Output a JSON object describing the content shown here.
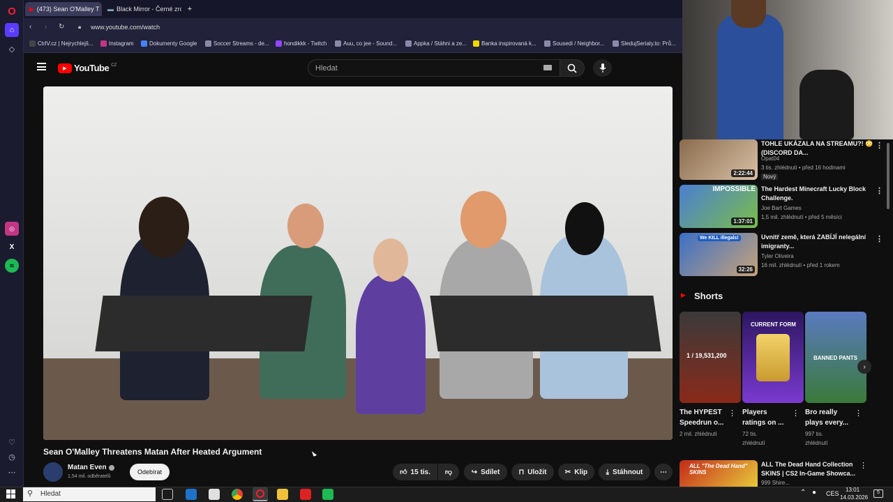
{
  "browser": {
    "tabs": [
      {
        "label": "(473) Sean O'Malley T"
      },
      {
        "label": "Black Mirror - Černé zrcad"
      }
    ],
    "url": "www.youtube.com/watch",
    "bookmarks": [
      "CtrlV.cz | Nejrychlejš...",
      "Instagram",
      "Dokumenty Google",
      "Soccer Streams - de...",
      "hondikkk - Twitch",
      "Auu, co jee - Sound...",
      "Appka / Stáhni a ze...",
      "Banka inspirovaná k...",
      "Sousedi / Neighbor...",
      "SledujSerialy.to: Prů..."
    ]
  },
  "youtube": {
    "logo": "YouTube",
    "country": "CZ",
    "search_placeholder": "Hledat",
    "video": {
      "title": "Sean O'Malley Threatens Matan After Heated Argument",
      "channel": "Matan Even",
      "subscribers": "1,54 mil. odběratelů",
      "subscribe_label": "Odebírat",
      "likes": "15 tis.",
      "share": "Sdílet",
      "save": "Uložit",
      "clip": "Klip",
      "download": "Stáhnout"
    },
    "recommended": [
      {
        "title": "TOHLE UKÁZALA NA STREAMU?! 😳 (DISCORD DA...",
        "channel": "Opat04",
        "meta": "3 tis. zhlédnutí • před 16 hodinami",
        "badge": "Nový",
        "duration": "2:22:44"
      },
      {
        "title": "The Hardest Minecraft Lucky Block Challenge.",
        "channel": "Joe Bart Games",
        "meta": "1,5 mil. zhlédnutí • před 5 měsíci",
        "duration": "1:37:01",
        "thumb_text": "IMPOSSIBLE"
      },
      {
        "title": "Uvnitř země, která ZABÍJÍ nelegální imigranty...",
        "channel": "Tyler Oliveira",
        "meta": "16 mil. zhlédnutí • před 1 rokem",
        "duration": "32:26",
        "thumb_text": "We KILL illegals!"
      }
    ],
    "shorts_heading": "Shorts",
    "shorts": [
      {
        "title": "The HYPEST Speedrun o...",
        "views": "2 mil. zhlédnutí",
        "overlay": "1 / 19,531,200"
      },
      {
        "title": "Players ratings on ...",
        "views": "72 tis. zhlédnutí",
        "overlay": "CURRENT FORM"
      },
      {
        "title": "Bro really plays every...",
        "views": "997 tis. zhlédnutí",
        "overlay": "BANNED PANTS"
      }
    ],
    "bottom_rec": {
      "title": "ALL The Dead Hand Collection SKINS | CS2 In-Game Showca...",
      "meta": "999 Shire...",
      "thumb_text": "ALL \"The Dead Hand\" SKINS"
    }
  },
  "taskbar": {
    "search_placeholder": "Hledat",
    "language": "CES",
    "time": "13:01",
    "date": "14.03.2026",
    "notifications": "5"
  },
  "colors": {
    "yt_red": "#ff0000",
    "background": "#0f0f0f",
    "opera_red": "#ff1b2d"
  }
}
